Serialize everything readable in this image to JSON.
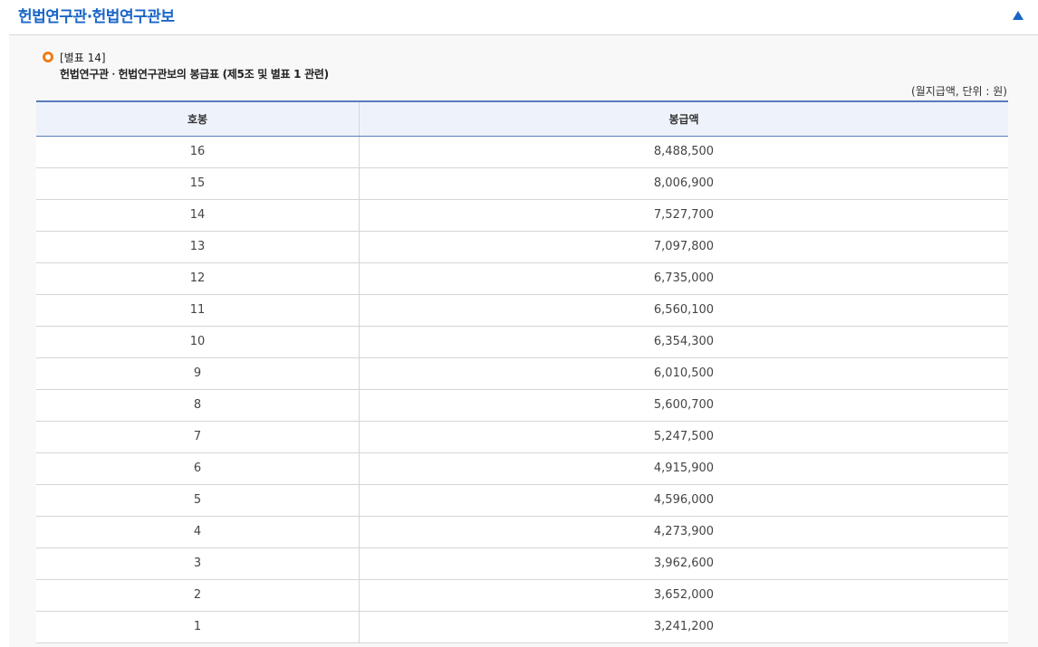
{
  "header": {
    "title": "헌법연구관·헌법연구관보",
    "toggle_icon": "triangle-up-icon",
    "accent_color": "#1a66c7"
  },
  "content": {
    "bullet_icon": "circle-bullet-icon",
    "bullet_color": "#ef7d1a",
    "appendix_label": "[별표 14]",
    "subtitle": "헌법연구관ㆍ헌법연구관보의 봉급표 (제5조 및 별표 1 관련)",
    "unit_note": "(월지급액, 단위 : 원)"
  },
  "table": {
    "columns": [
      "호봉",
      "봉급액"
    ],
    "rows": [
      {
        "step": "16",
        "amount": "8,488,500"
      },
      {
        "step": "15",
        "amount": "8,006,900"
      },
      {
        "step": "14",
        "amount": "7,527,700"
      },
      {
        "step": "13",
        "amount": "7,097,800"
      },
      {
        "step": "12",
        "amount": "6,735,000"
      },
      {
        "step": "11",
        "amount": "6,560,100"
      },
      {
        "step": "10",
        "amount": "6,354,300"
      },
      {
        "step": "9",
        "amount": "6,010,500"
      },
      {
        "step": "8",
        "amount": "5,600,700"
      },
      {
        "step": "7",
        "amount": "5,247,500"
      },
      {
        "step": "6",
        "amount": "4,915,900"
      },
      {
        "step": "5",
        "amount": "4,596,000"
      },
      {
        "step": "4",
        "amount": "4,273,900"
      },
      {
        "step": "3",
        "amount": "3,962,600"
      },
      {
        "step": "2",
        "amount": "3,652,000"
      },
      {
        "step": "1",
        "amount": "3,241,200"
      }
    ]
  }
}
